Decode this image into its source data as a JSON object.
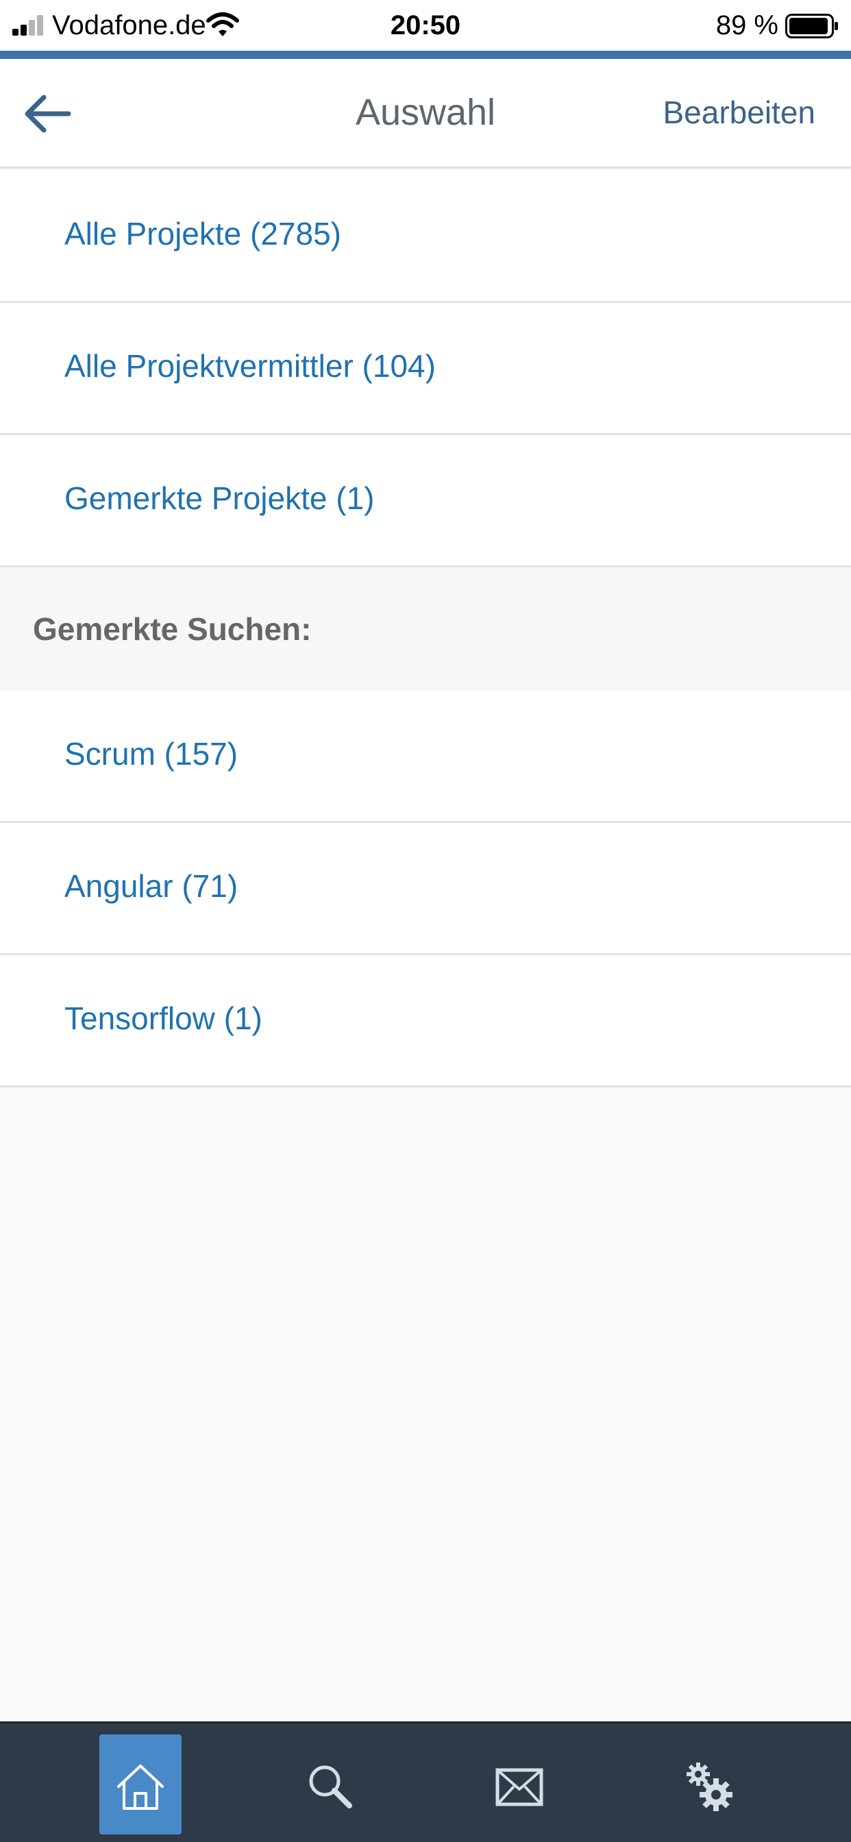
{
  "status_bar": {
    "carrier": "Vodafone.de",
    "time": "20:50",
    "battery_percent": "89 %",
    "icons": [
      "signal-icon",
      "wifi-icon",
      "battery-icon"
    ]
  },
  "nav": {
    "back_icon": "arrow-left-icon",
    "title": "Auswahl",
    "edit_label": "Bearbeiten"
  },
  "main_list": [
    {
      "label": "Alle Projekte (2785)"
    },
    {
      "label": "Alle Projektvermittler (104)"
    },
    {
      "label": "Gemerkte Projekte (1)"
    }
  ],
  "saved_searches": {
    "header": "Gemerkte Suchen:",
    "items": [
      {
        "label": "Scrum (157)"
      },
      {
        "label": "Angular (71)"
      },
      {
        "label": "Tensorflow (1)"
      }
    ]
  },
  "tab_bar": {
    "tabs": [
      {
        "icon": "home-icon",
        "active": true
      },
      {
        "icon": "search-icon",
        "active": false
      },
      {
        "icon": "mail-icon",
        "active": false
      },
      {
        "icon": "settings-gears-icon",
        "active": false
      }
    ]
  },
  "colors": {
    "accent": "#3f72a8",
    "link": "#1f72b0",
    "tab_bar_bg": "#2e3a47",
    "tab_active_bg": "#4a89c8"
  }
}
